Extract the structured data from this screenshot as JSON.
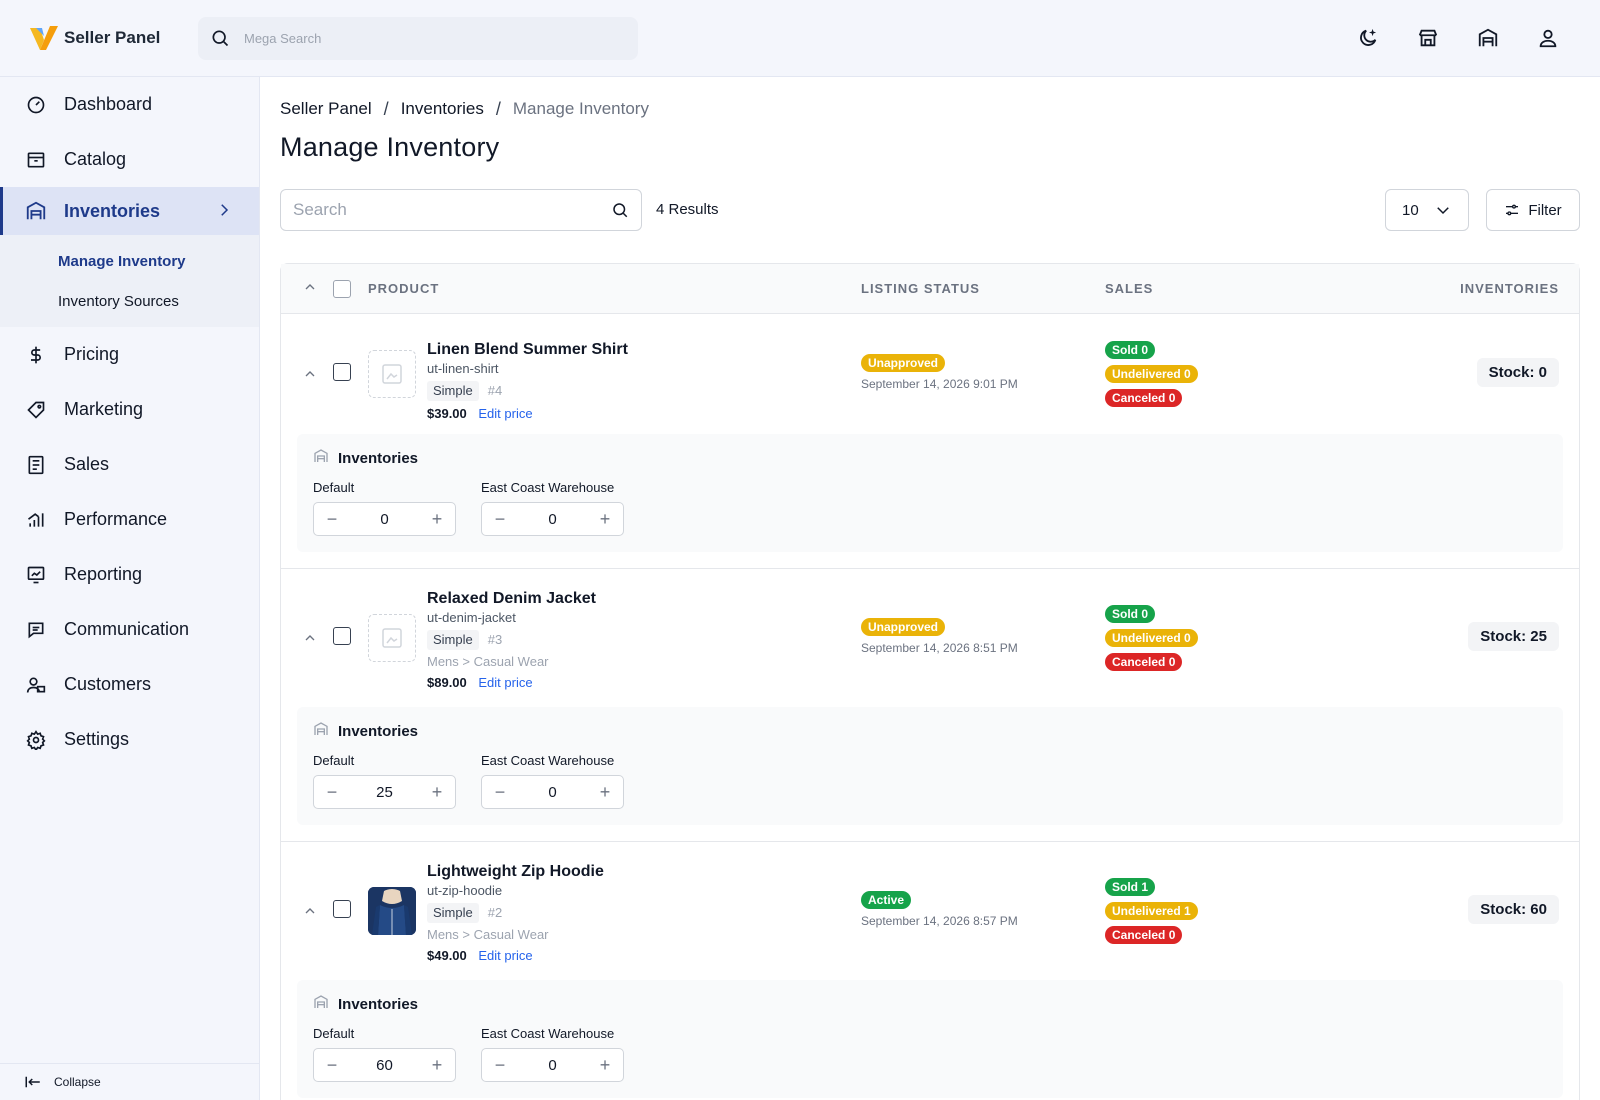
{
  "header": {
    "brand": "Seller Panel",
    "search_placeholder": "Mega Search",
    "actions": [
      "moon-icon",
      "store-icon",
      "warehouse-icon",
      "user-icon"
    ]
  },
  "sidebar": {
    "items": [
      {
        "label": "Dashboard",
        "icon": "gauge-icon"
      },
      {
        "label": "Catalog",
        "icon": "box-icon"
      },
      {
        "label": "Inventories",
        "icon": "warehouse-icon",
        "active": true
      },
      {
        "label": "Pricing",
        "icon": "dollar-icon"
      },
      {
        "label": "Marketing",
        "icon": "tag-icon"
      },
      {
        "label": "Sales",
        "icon": "receipt-icon"
      },
      {
        "label": "Performance",
        "icon": "bar-chart-icon"
      },
      {
        "label": "Reporting",
        "icon": "report-icon"
      },
      {
        "label": "Communication",
        "icon": "message-icon"
      },
      {
        "label": "Customers",
        "icon": "customers-icon"
      },
      {
        "label": "Settings",
        "icon": "gear-icon"
      }
    ],
    "subitems": [
      {
        "label": "Manage Inventory",
        "active": true
      },
      {
        "label": "Inventory Sources"
      }
    ],
    "collapse_label": "Collapse"
  },
  "breadcrumb": [
    "Seller Panel",
    "Inventories",
    "Manage Inventory"
  ],
  "page_title": "Manage Inventory",
  "toolbar": {
    "search_placeholder": "Search",
    "results": "4 Results",
    "per_page": "10",
    "filter_label": "Filter"
  },
  "table": {
    "headers": {
      "product": "PRODUCT",
      "status": "LISTING STATUS",
      "sales": "SALES",
      "inventories": "INVENTORIES"
    },
    "rows": [
      {
        "name": "Linen Blend Summer Shirt",
        "sku": "ut-linen-shirt",
        "type": "Simple",
        "id": "#4",
        "category": "",
        "price": "$39.00",
        "edit_price": "Edit price",
        "status": "Unapproved",
        "date": "September 14, 2026 9:01 PM",
        "sold": "Sold 0",
        "undelivered": "Undelivered 0",
        "canceled": "Canceled 0",
        "stock": "Stock: 0",
        "inv_title": "Inventories",
        "sources": [
          {
            "label": "Default",
            "qty": "0"
          },
          {
            "label": "East Coast Warehouse",
            "qty": "0"
          }
        ]
      },
      {
        "name": "Relaxed Denim Jacket",
        "sku": "ut-denim-jacket",
        "type": "Simple",
        "id": "#3",
        "category": "Mens > Casual Wear",
        "price": "$89.00",
        "edit_price": "Edit price",
        "status": "Unapproved",
        "date": "September 14, 2026 8:51 PM",
        "sold": "Sold 0",
        "undelivered": "Undelivered 0",
        "canceled": "Canceled 0",
        "stock": "Stock: 25",
        "inv_title": "Inventories",
        "sources": [
          {
            "label": "Default",
            "qty": "25"
          },
          {
            "label": "East Coast Warehouse",
            "qty": "0"
          }
        ]
      },
      {
        "name": "Lightweight Zip Hoodie",
        "sku": "ut-zip-hoodie",
        "type": "Simple",
        "id": "#2",
        "category": "Mens > Casual Wear",
        "price": "$49.00",
        "edit_price": "Edit price",
        "status": "Active",
        "date": "September 14, 2026 8:57 PM",
        "sold": "Sold 1",
        "undelivered": "Undelivered 1",
        "canceled": "Canceled 0",
        "stock": "Stock: 60",
        "inv_title": "Inventories",
        "sources": [
          {
            "label": "Default",
            "qty": "60"
          },
          {
            "label": "East Coast Warehouse",
            "qty": "0"
          }
        ]
      }
    ]
  },
  "colors": {
    "accent": "#1e3a8a",
    "link": "#2563eb",
    "success": "#16a34a",
    "warning": "#eab308",
    "danger": "#dc2626"
  }
}
